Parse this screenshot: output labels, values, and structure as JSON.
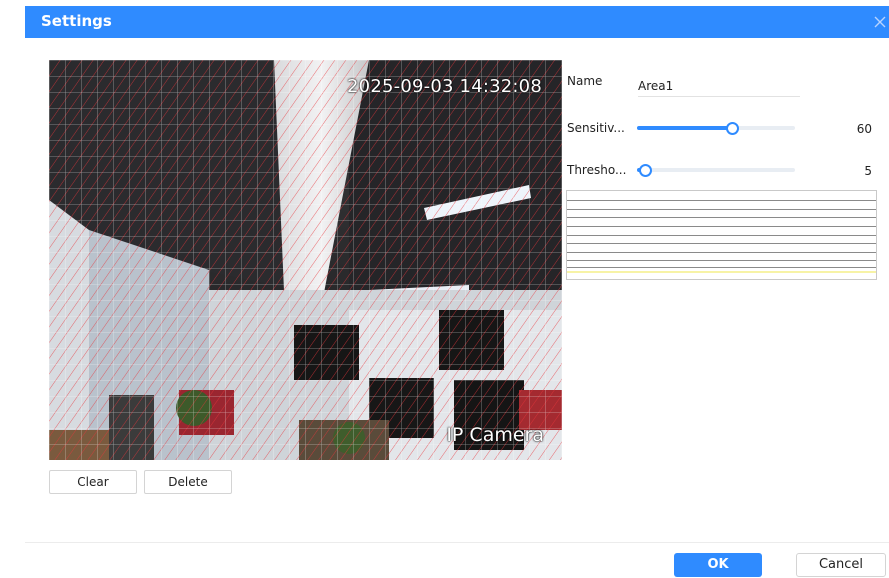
{
  "dialog": {
    "title": "Settings",
    "close_icon": "close-icon"
  },
  "preview": {
    "timestamp": "2025-09-03 14:32:08",
    "camera_label": "IP Camera",
    "grid_color": "#e8343a"
  },
  "actions": {
    "clear_label": "Clear",
    "delete_label": "Delete"
  },
  "properties": {
    "name_label": "Name",
    "name_value": "Area1",
    "sensitivity_label": "Sensitiv...",
    "sensitivity_value": "60",
    "sensitivity_level": 0.6,
    "threshold_label": "Thresho...",
    "threshold_value": "5",
    "threshold_level": 0.05
  },
  "colors": {
    "accent": "#2f8bff",
    "titlebar": "#2f8bff"
  },
  "footer": {
    "ok_label": "OK",
    "cancel_label": "Cancel"
  }
}
